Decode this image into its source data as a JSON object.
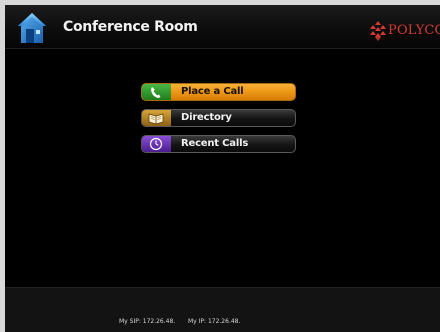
{
  "header": {
    "room_name": "Conference Room",
    "home_icon": "home-icon",
    "brand": {
      "name": "POLYCOM",
      "icon": "polycom-logo-icon",
      "color": "#d43a32"
    }
  },
  "menu": {
    "items": [
      {
        "label": "Place a Call",
        "icon": "phone-icon",
        "icon_color": "#2f9a2c",
        "selected": true
      },
      {
        "label": "Directory",
        "icon": "book-icon",
        "icon_color": "#b8861e",
        "selected": false
      },
      {
        "label": "Recent Calls",
        "icon": "clock-icon",
        "icon_color": "#6b2fb4",
        "selected": false
      }
    ],
    "highlight_color": "#ee9a17"
  },
  "footer": {
    "sip_text": "My SIP: 172.26.48.",
    "ip_text": "My IP: 172.26.48."
  }
}
